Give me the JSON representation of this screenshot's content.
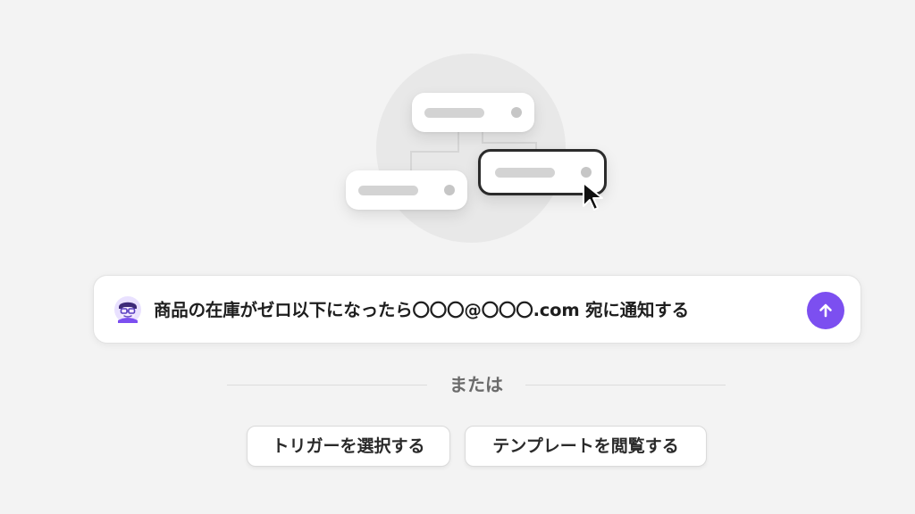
{
  "prompt": {
    "text": "商品の在庫がゼロ以下になったら〇〇〇@〇〇〇.com 宛に通知する",
    "avatar_icon": "robot-avatar-icon",
    "send_icon": "arrow-up-icon",
    "accent_color": "#7c4ff0"
  },
  "divider": {
    "label": "または"
  },
  "actions": {
    "select_trigger_label": "トリガーを選択する",
    "browse_templates_label": "テンプレートを閲覧する"
  }
}
